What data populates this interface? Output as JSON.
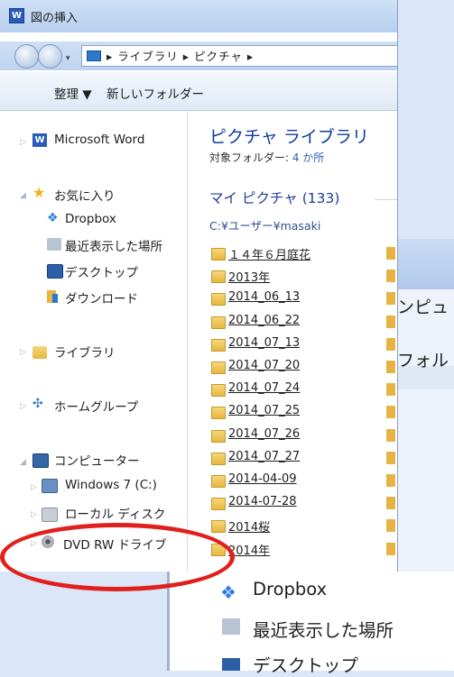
{
  "window": {
    "title": "図の挿入",
    "app_badge": "W"
  },
  "address": {
    "separator": "▸",
    "path": [
      "ライブラリ",
      "ピクチャ"
    ],
    "trail": "▸"
  },
  "toolbar": {
    "organize": "整理 ▼",
    "new_folder": "新しいフォルダー"
  },
  "nav": {
    "microsoft_word": "Microsoft Word",
    "favorites": "お気に入り",
    "dropbox": "Dropbox",
    "recent": "最近表示した場所",
    "desktop": "デスクトップ",
    "downloads": "ダウンロード",
    "library": "ライブラリ",
    "homegroup": "ホームグループ",
    "computer": "コンピューター",
    "windows": "Windows 7 (C:)",
    "local_disk": "ローカル ディスク",
    "dvd": "DVD RW ドライブ"
  },
  "content": {
    "library_title": "ピクチャ ライブラリ",
    "target_label": "対象フォルダー: ",
    "target_value": "4 か所",
    "group_title": "マイ ピクチャ (133)",
    "group_path": "C:¥ユーザー¥masaki",
    "folders": [
      "１４年６月庭花",
      "2013年",
      "2014_06_13",
      "2014_06_22",
      "2014_07_13",
      "2014_07_20",
      "2014_07_24",
      "2014_07_25",
      "2014_07_26",
      "2014_07_27",
      "2014-04-09",
      "2014-07-28",
      "2014桜",
      "2014年"
    ]
  },
  "second_window": {
    "line1": "ンピュ",
    "line2": "フォル"
  },
  "zoomed": {
    "dropbox": "Dropbox",
    "recent": "最近表示した場所",
    "desktop": "デスクトップ"
  },
  "colors": {
    "highlight": "#e0201c",
    "library_title": "#0f3b9c"
  }
}
